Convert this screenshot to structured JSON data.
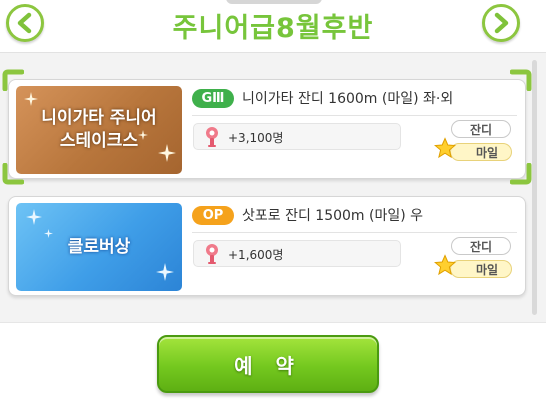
{
  "header": {
    "title": "주니어급8월후반",
    "prev_icon": "chevron-left-icon",
    "next_icon": "chevron-right-icon",
    "accent_color": "#77c53b"
  },
  "races": [
    {
      "thumbnail_name": "니이가타 주니어\n스테이크스",
      "grade": "GⅢ",
      "grade_color": "#3fb04b",
      "info": "니이가타 잔디 1600m (마일) 좌·외",
      "fans": "+3,100명",
      "surface": "잔디",
      "distance": "마일",
      "selected": true
    },
    {
      "thumbnail_name": "클로버상",
      "grade": "OP",
      "grade_color": "#f5a21c",
      "info": "삿포로 잔디 1500m (마일) 우",
      "fans": "+1,600명",
      "surface": "잔디",
      "distance": "마일",
      "selected": false
    }
  ],
  "footer": {
    "reserve_label": "예 약"
  }
}
